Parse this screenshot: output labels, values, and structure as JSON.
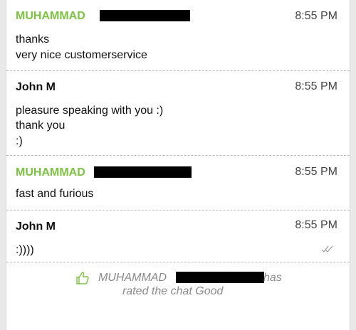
{
  "messages": [
    {
      "sender": "MUHAMMAD",
      "role": "customer",
      "time": "8:55 PM",
      "lines": [
        "thanks",
        "very nice customerservice"
      ]
    },
    {
      "sender": "John M",
      "role": "agent",
      "time": "8:55 PM",
      "lines": [
        "pleasure speaking with you :)",
        "thank you",
        ":)"
      ]
    },
    {
      "sender": "MUHAMMAD",
      "role": "customer",
      "time": "8:55 PM",
      "lines": [
        "fast and furious"
      ]
    },
    {
      "sender": "John M",
      "role": "agent",
      "time": "8:55 PM",
      "lines": [
        ":))))"
      ],
      "read_icon": "double-check-icon"
    }
  ],
  "rating": {
    "icon": "thumbs-up-icon",
    "name": "MUHAMMAD",
    "suffix": "has",
    "line2": "rated the chat Good"
  },
  "colors": {
    "customer_name": "#7cc242",
    "agent_name": "#111111",
    "rating_text": "#8a8a8a"
  }
}
